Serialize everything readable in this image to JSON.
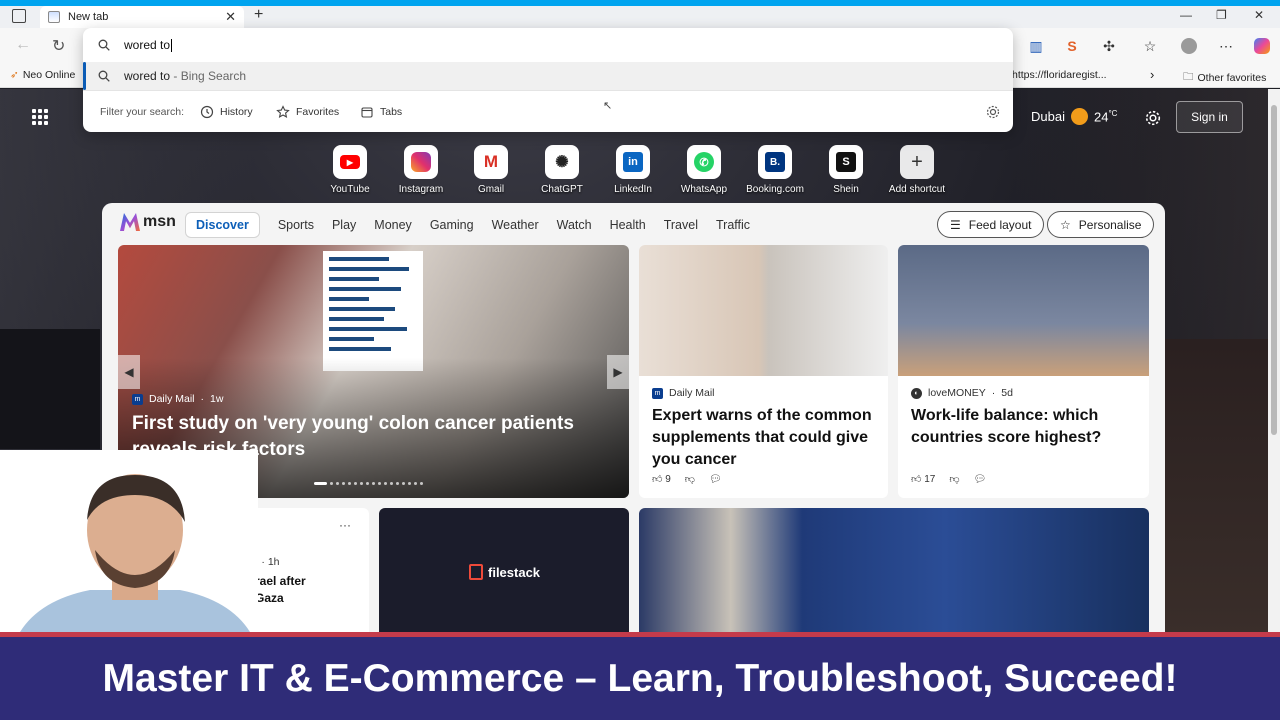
{
  "tab": {
    "title": "New tab"
  },
  "address": {
    "typed": "wored to"
  },
  "suggestion": {
    "query": "wored to",
    "suffix": " - Bing Search"
  },
  "filter": {
    "label": "Filter your search:",
    "items": [
      "History",
      "Favorites",
      "Tabs"
    ]
  },
  "favorites": {
    "left": "Neo Online",
    "right_url": "https://floridaregist...",
    "other": "Other favorites"
  },
  "header": {
    "city": "Dubai",
    "temp": "24",
    "unit": "°C",
    "signin": "Sign in"
  },
  "shortcuts": [
    {
      "label": "YouTube"
    },
    {
      "label": "Instagram"
    },
    {
      "label": "Gmail"
    },
    {
      "label": "ChatGPT"
    },
    {
      "label": "LinkedIn"
    },
    {
      "label": "WhatsApp"
    },
    {
      "label": "Booking.com",
      "glyph": "B."
    },
    {
      "label": "Shein",
      "glyph": "S"
    },
    {
      "label": "Add shortcut"
    }
  ],
  "feed": {
    "logo": "msn",
    "tabs": [
      "Discover",
      "Sports",
      "Play",
      "Money",
      "Gaming",
      "Weather",
      "Watch",
      "Health",
      "Travel",
      "Traffic"
    ],
    "feed_layout": "Feed layout",
    "personalise": "Personalise",
    "hero": {
      "source": "Daily Mail",
      "age": "1w",
      "title": "First study on 'very young' colon cancer patients reveals risk factors"
    },
    "card1": {
      "source": "Daily Mail",
      "title": "Expert warns of the common supplements that could give you cancer",
      "likes": "9"
    },
    "card2": {
      "source": "loveMONEY",
      "age": "5d",
      "title": "Work-life balance: which countries score highest?",
      "likes": "17"
    },
    "row2": {
      "age": "1h",
      "snippet1": "rael after",
      "snippet2": "Gaza",
      "ad": "filestack"
    }
  },
  "banner": {
    "text": "Master IT & E-Commerce – Learn, Troubleshoot, Succeed!"
  },
  "colors": {
    "accent": "#00a4ef",
    "banner_bg": "#2f2c78",
    "banner_border": "#c43b4b",
    "link_blue": "#0d5fb8"
  }
}
